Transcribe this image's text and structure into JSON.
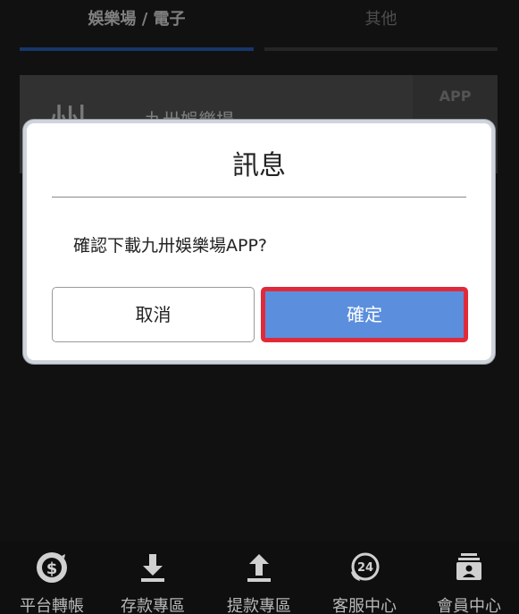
{
  "tabs": [
    {
      "label": "娛樂場 / 電子",
      "active": true
    },
    {
      "label": "其他",
      "active": false
    }
  ],
  "card": {
    "logo_text": "州",
    "title": "九卅娛樂場",
    "badge": "APP"
  },
  "dialog": {
    "title": "訊息",
    "message": "確認下載九卅娛樂場APP?",
    "cancel_label": "取消",
    "confirm_label": "確定"
  },
  "bottom_nav": [
    {
      "label": "平台轉帳",
      "icon": "dollar-transfer-icon"
    },
    {
      "label": "存款專區",
      "icon": "download-arrow-icon"
    },
    {
      "label": "提款專區",
      "icon": "upload-arrow-icon"
    },
    {
      "label": "客服中心",
      "icon": "support-24-icon",
      "icon_text": "24"
    },
    {
      "label": "會員中心",
      "icon": "member-card-icon"
    }
  ],
  "colors": {
    "accent": "#2b63c0",
    "confirm": "#5b8fdd",
    "highlight": "#e02a3a"
  }
}
